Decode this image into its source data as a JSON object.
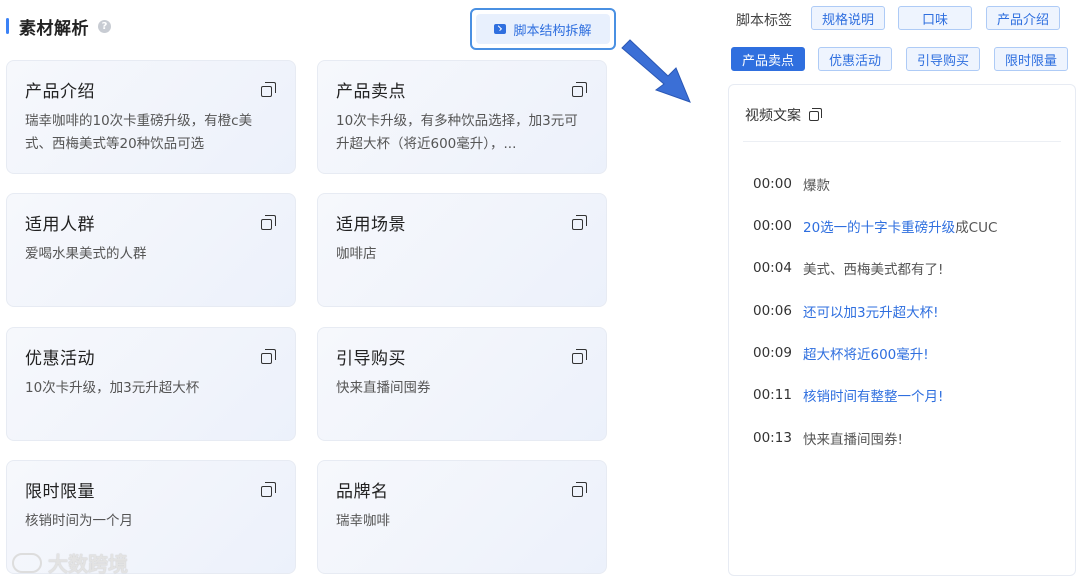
{
  "header": {
    "title": "素材解析",
    "help_icon": "?",
    "deconstruct_button": "脚本结构拆解"
  },
  "cards": [
    {
      "title": "产品介绍",
      "body": "瑞幸咖啡的10次卡重磅升级，有橙c美式、西梅美式等20种饮品可选"
    },
    {
      "title": "产品卖点",
      "body": "10次卡升级，有多种饮品选择，加3元可升超大杯（将近600毫升），..."
    },
    {
      "title": "适用人群",
      "body": "爱喝水果美式的人群"
    },
    {
      "title": "适用场景",
      "body": "咖啡店"
    },
    {
      "title": "优惠活动",
      "body": "10次卡升级，加3元升超大杯"
    },
    {
      "title": "引导购买",
      "body": "快来直播间囤券"
    },
    {
      "title": "限时限量",
      "body": "核销时间为一个月"
    },
    {
      "title": "品牌名",
      "body": "瑞幸咖啡"
    }
  ],
  "script_tags": {
    "label": "脚本标签",
    "tags": [
      "规格说明",
      "口味",
      "产品介绍",
      "产品卖点",
      "优惠活动",
      "引导购买",
      "限时限量"
    ],
    "active": "产品卖点"
  },
  "video_copy": {
    "title": "视频文案",
    "lines": [
      {
        "time": "00:00",
        "text": "爆款",
        "highlight": "",
        "rest": ""
      },
      {
        "time": "00:00",
        "text": "",
        "highlight": "20选一的十字卡重磅升级",
        "rest": "成CUC"
      },
      {
        "time": "00:04",
        "text": "美式、西梅美式都有了!",
        "highlight": "",
        "rest": ""
      },
      {
        "time": "00:06",
        "text": "",
        "highlight": "还可以加3元升超大杯!",
        "rest": ""
      },
      {
        "time": "00:09",
        "text": "",
        "highlight": "超大杯将近600毫升!",
        "rest": ""
      },
      {
        "time": "00:11",
        "text": "",
        "highlight": "核销时间有整整一个月!",
        "rest": ""
      },
      {
        "time": "00:13",
        "text": "快来直播间囤券!",
        "highlight": "",
        "rest": ""
      }
    ]
  },
  "watermark": "大数跨境",
  "colors": {
    "accent": "#2f6fdf",
    "arrow": "#3b6fd6"
  }
}
